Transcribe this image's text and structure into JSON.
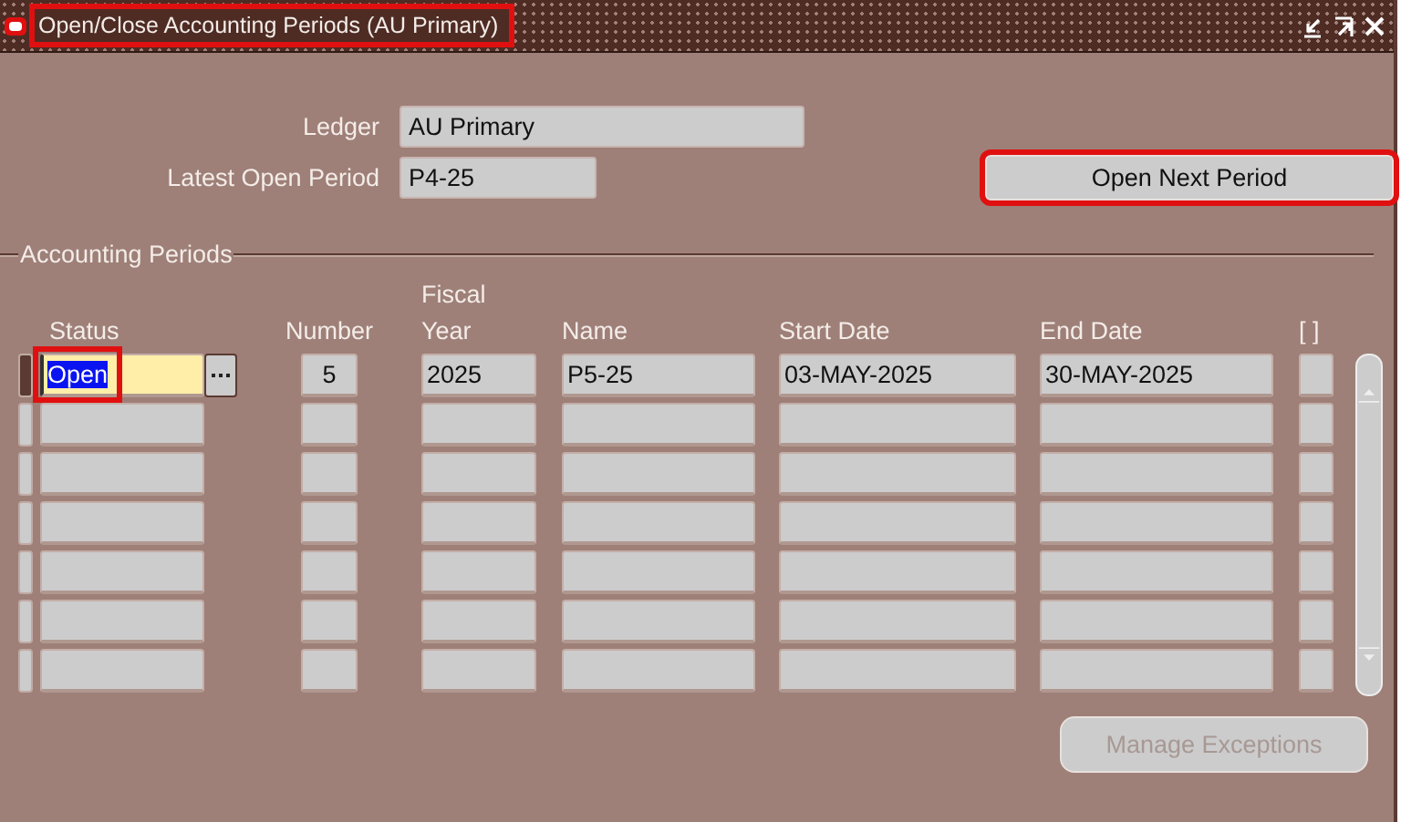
{
  "window": {
    "title": "Open/Close Accounting Periods (AU Primary)",
    "title_highlighted": true
  },
  "header_fields": [
    {
      "label": "Ledger",
      "value": "AU Primary"
    },
    {
      "label": "Latest Open Period",
      "value": "P4-25"
    }
  ],
  "open_next_button": {
    "label": "Open Next Period",
    "highlighted": true
  },
  "section": {
    "title": "Accounting Periods"
  },
  "table": {
    "columns": [
      "Status",
      "Number",
      "Fiscal\nYear",
      "Name",
      "Start Date",
      "End Date",
      "[ ]"
    ],
    "rows": [
      {
        "selected": true,
        "highlighted": true,
        "status": "Open",
        "number": "5",
        "fiscal_year": "2025",
        "name": "P5-25",
        "start_date": "03-MAY-2025",
        "end_date": "30-MAY-2025"
      },
      {
        "selected": false
      },
      {
        "selected": false
      },
      {
        "selected": false
      },
      {
        "selected": false
      },
      {
        "selected": false
      },
      {
        "selected": false
      }
    ]
  },
  "manage_exceptions_button": {
    "label": "Manage Exceptions",
    "disabled": true
  }
}
